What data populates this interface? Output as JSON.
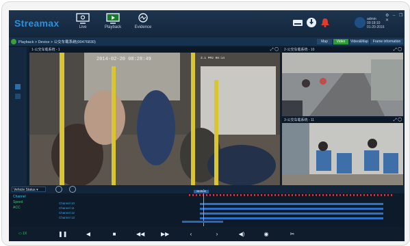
{
  "app": {
    "logo_text": "Streamax"
  },
  "nav": [
    {
      "label": "Live"
    },
    {
      "label": "Playback"
    },
    {
      "label": "Evidence"
    }
  ],
  "user": {
    "name": "admin",
    "time": "00:18:10",
    "date": "01-20-2016"
  },
  "breadcrumb": "Playback > Device > 公交车载系统(00476830)",
  "tabs": [
    {
      "label": "Map"
    },
    {
      "label": "Video"
    },
    {
      "label": "Video&Map"
    },
    {
      "label": "Frame information"
    }
  ],
  "panes": [
    {
      "title": "1-公交车载系统 - 1",
      "osd_time": "2014-02-20 08:28:49",
      "osd_small": "3.1 PM2 08:14",
      "osd_bottom": ""
    },
    {
      "title": "2-公交车载系统 - 10",
      "osd_time": "",
      "osd_small": "",
      "osd_bottom": ""
    },
    {
      "title": "3-公交车载系统 - 11",
      "osd_time": "",
      "osd_small": "",
      "osd_bottom": ""
    }
  ],
  "timeline": {
    "status_select": "Vehicle Status",
    "list": [
      "Channel",
      "Speed",
      "ACC"
    ],
    "channels": [
      "Channel 10",
      "Channel 11",
      "Channel 12",
      "Channel 13"
    ],
    "ticks": [
      "",
      "",
      "",
      "",
      "",
      "",
      "",
      "",
      ""
    ],
    "cursor_label": "08:28:49"
  },
  "controls": {
    "speed": "1X"
  },
  "colors": {
    "accent_green": "#2f9b3b",
    "accent_blue": "#2d72c8",
    "record_red": "#d23232"
  }
}
